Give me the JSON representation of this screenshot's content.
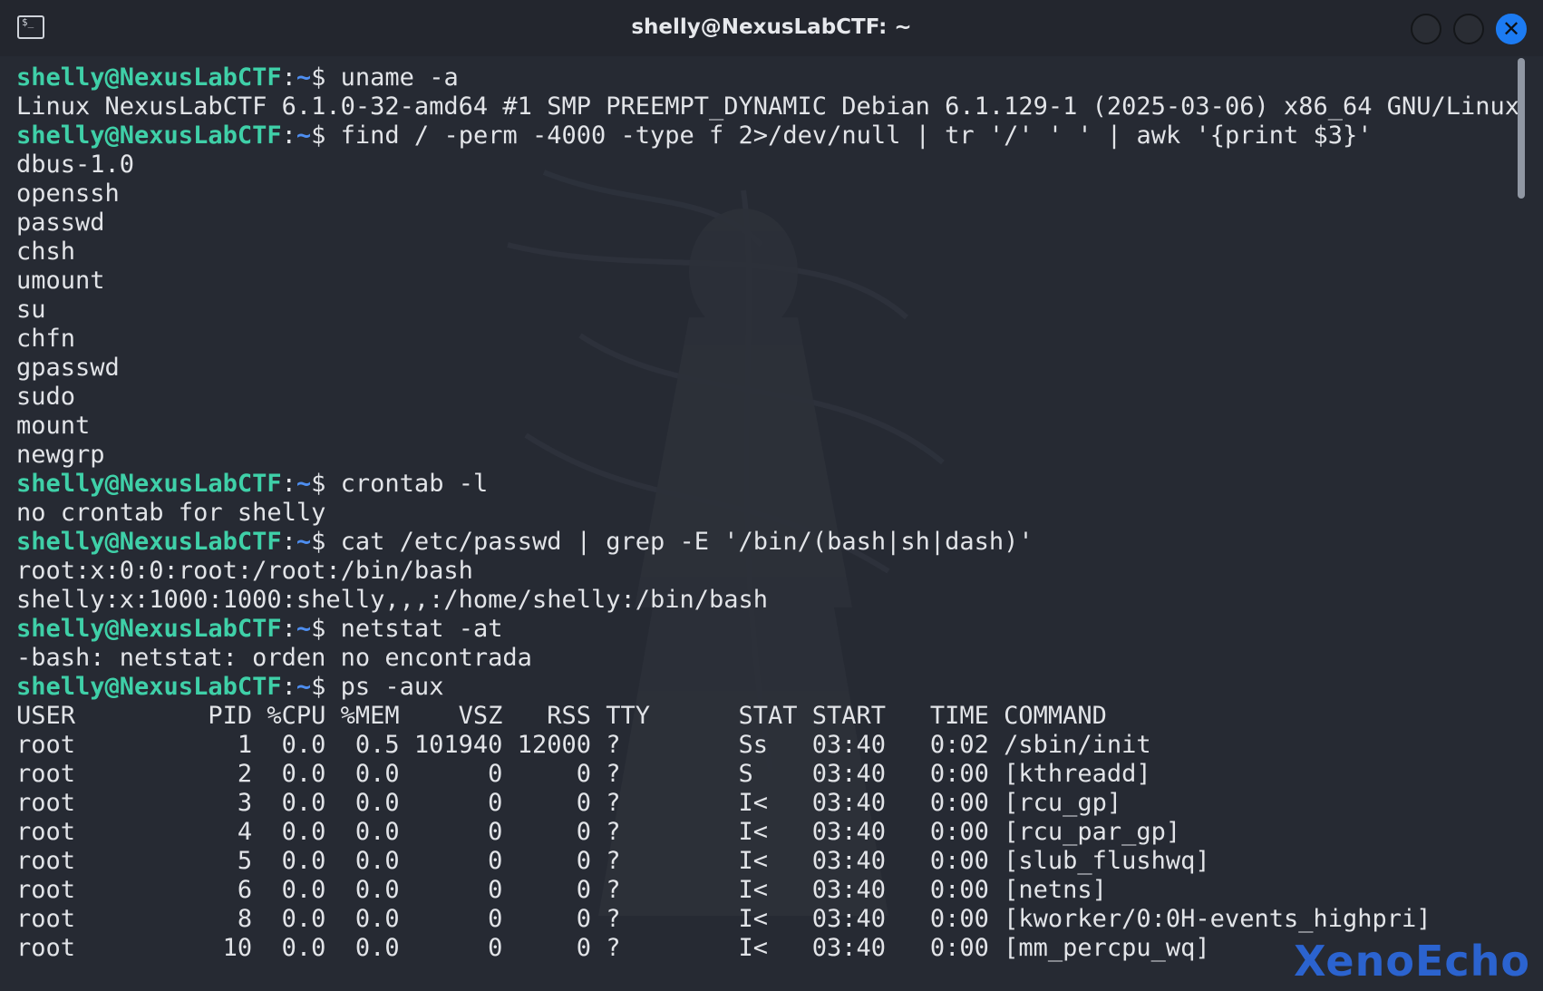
{
  "window": {
    "title": "shelly@NexusLabCTF: ~",
    "app_icon": "terminal-icon",
    "app_icon_glyph": "$_",
    "close_glyph": "✕"
  },
  "prompt": {
    "user_host": "shelly@NexusLabCTF",
    "colon": ":",
    "path": "~",
    "dollar": "$ "
  },
  "lines": [
    {
      "prompt": true,
      "cmd": "uname -a"
    },
    {
      "text": "Linux NexusLabCTF 6.1.0-32-amd64 #1 SMP PREEMPT_DYNAMIC Debian 6.1.129-1 (2025-03-06) x86_64 GNU/Linux"
    },
    {
      "prompt": true,
      "cmd": "find / -perm -4000 -type f 2>/dev/null | tr '/' ' ' | awk '{print $3}'"
    },
    {
      "text": "dbus-1.0"
    },
    {
      "text": "openssh"
    },
    {
      "text": "passwd"
    },
    {
      "text": "chsh"
    },
    {
      "text": "umount"
    },
    {
      "text": "su"
    },
    {
      "text": "chfn"
    },
    {
      "text": "gpasswd"
    },
    {
      "text": "sudo"
    },
    {
      "text": "mount"
    },
    {
      "text": "newgrp"
    },
    {
      "prompt": true,
      "cmd": "crontab -l"
    },
    {
      "text": "no crontab for shelly"
    },
    {
      "prompt": true,
      "cmd": "cat /etc/passwd | grep -E '/bin/(bash|sh|dash)'"
    },
    {
      "text": "root:x:0:0:root:/root:/bin/bash"
    },
    {
      "text": "shelly:x:1000:1000:shelly,,,:/home/shelly:/bin/bash"
    },
    {
      "prompt": true,
      "cmd": "netstat -at"
    },
    {
      "text": "-bash: netstat: orden no encontrada"
    },
    {
      "prompt": true,
      "cmd": "ps -aux"
    },
    {
      "text": "USER         PID %CPU %MEM    VSZ   RSS TTY      STAT START   TIME COMMAND"
    },
    {
      "text": "root           1  0.0  0.5 101940 12000 ?        Ss   03:40   0:02 /sbin/init"
    },
    {
      "text": "root           2  0.0  0.0      0     0 ?        S    03:40   0:00 [kthreadd]"
    },
    {
      "text": "root           3  0.0  0.0      0     0 ?        I<   03:40   0:00 [rcu_gp]"
    },
    {
      "text": "root           4  0.0  0.0      0     0 ?        I<   03:40   0:00 [rcu_par_gp]"
    },
    {
      "text": "root           5  0.0  0.0      0     0 ?        I<   03:40   0:00 [slub_flushwq]"
    },
    {
      "text": "root           6  0.0  0.0      0     0 ?        I<   03:40   0:00 [netns]"
    },
    {
      "text": "root           8  0.0  0.0      0     0 ?        I<   03:40   0:00 [kworker/0:0H-events_highpri]"
    },
    {
      "text": "root          10  0.0  0.0      0     0 ?        I<   03:40   0:00 [mm_percpu_wq]"
    }
  ],
  "watermark": "XenoEcho",
  "colors": {
    "background": "#262a33",
    "prompt_user": "#3fd0a8",
    "prompt_path": "#4e8ef0",
    "close_button": "#1c7bf2",
    "watermark": "#2b63cf"
  }
}
